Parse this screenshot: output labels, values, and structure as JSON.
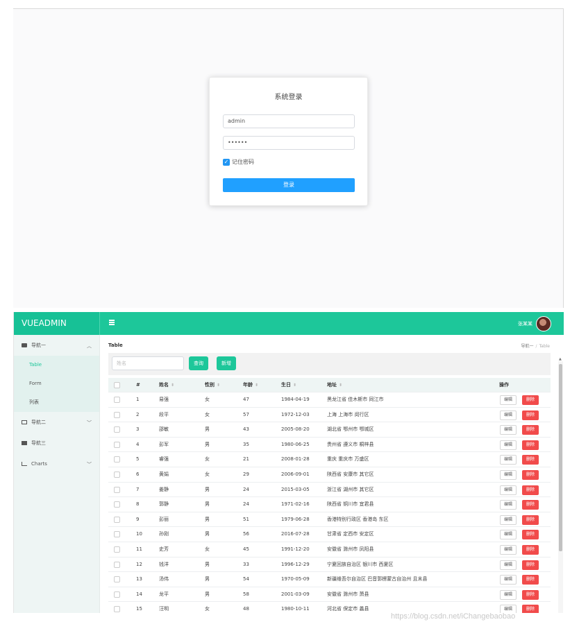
{
  "login": {
    "title": "系统登录",
    "username_value": "admin",
    "password_value": "••••••",
    "remember_label": "记住密码",
    "remember_checked": true,
    "submit_label": "登录"
  },
  "header": {
    "brand": "VUEADMIN",
    "menu_icon": "hamburger-icon",
    "username": "张某某",
    "accent_color": "#1dc79a"
  },
  "sidebar": {
    "nav1_label": "导航一",
    "nav1_sub": [
      "Table",
      "Form",
      "列表"
    ],
    "nav2_label": "导航二",
    "nav3_label": "导航三",
    "charts_label": "Charts"
  },
  "main": {
    "title": "Table",
    "breadcrumb_root": "导航一",
    "breadcrumb_sep": "/",
    "breadcrumb_current": "Table",
    "search_placeholder": "姓名",
    "query_label": "查询",
    "add_label": "新增",
    "columns": [
      "#",
      "姓名",
      "性别",
      "年龄",
      "生日",
      "地址",
      "操作"
    ],
    "edit_label": "编辑",
    "delete_label": "删除",
    "delete_color": "#f14b4b",
    "rows": [
      {
        "no": "1",
        "name": "易强",
        "sex": "女",
        "age": "47",
        "birth": "1984-04-19",
        "addr": "黑龙江省 佳木斯市 同江市"
      },
      {
        "no": "2",
        "name": "段平",
        "sex": "女",
        "age": "57",
        "birth": "1972-12-03",
        "addr": "上海 上海市 闵行区"
      },
      {
        "no": "3",
        "name": "邵敏",
        "sex": "男",
        "age": "43",
        "birth": "2005-08-20",
        "addr": "湖北省 鄂州市 鄂城区"
      },
      {
        "no": "4",
        "name": "彭军",
        "sex": "男",
        "age": "35",
        "birth": "1980-06-25",
        "addr": "贵州省 遵义市 桐梓县"
      },
      {
        "no": "5",
        "name": "睿强",
        "sex": "女",
        "age": "21",
        "birth": "2008-01-28",
        "addr": "重庆 重庆市 万盛区"
      },
      {
        "no": "6",
        "name": "黄娟",
        "sex": "女",
        "age": "29",
        "birth": "2006-09-01",
        "addr": "陕西省 安康市 其它区"
      },
      {
        "no": "7",
        "name": "姜静",
        "sex": "男",
        "age": "24",
        "birth": "2015-03-05",
        "addr": "浙江省 湖州市 其它区"
      },
      {
        "no": "8",
        "name": "郭静",
        "sex": "男",
        "age": "24",
        "birth": "1971-02-16",
        "addr": "陕西省 铜川市 宜君县"
      },
      {
        "no": "9",
        "name": "彭丽",
        "sex": "男",
        "age": "51",
        "birth": "1979-06-28",
        "addr": "香港特别行政区 香港岛 东区"
      },
      {
        "no": "10",
        "name": "孙刚",
        "sex": "男",
        "age": "56",
        "birth": "2016-07-28",
        "addr": "甘肃省 定西市 安定区"
      },
      {
        "no": "11",
        "name": "史芳",
        "sex": "女",
        "age": "45",
        "birth": "1991-12-20",
        "addr": "安徽省 滁州市 凤阳县"
      },
      {
        "no": "12",
        "name": "钱洋",
        "sex": "男",
        "age": "33",
        "birth": "1996-12-29",
        "addr": "宁夏回族自治区 银川市 西夏区"
      },
      {
        "no": "13",
        "name": "汤伟",
        "sex": "男",
        "age": "54",
        "birth": "1970-05-09",
        "addr": "新疆维吾尔自治区 巴音郭楞蒙古自治州 且末县"
      },
      {
        "no": "14",
        "name": "龙平",
        "sex": "男",
        "age": "58",
        "birth": "2001-03-09",
        "addr": "安徽省 滁州市 萧县"
      },
      {
        "no": "15",
        "name": "汪明",
        "sex": "女",
        "age": "48",
        "birth": "1980-10-11",
        "addr": "河北省 保定市 蠡县"
      }
    ]
  },
  "watermark": "https://blog.csdn.net/iChangebaobao"
}
